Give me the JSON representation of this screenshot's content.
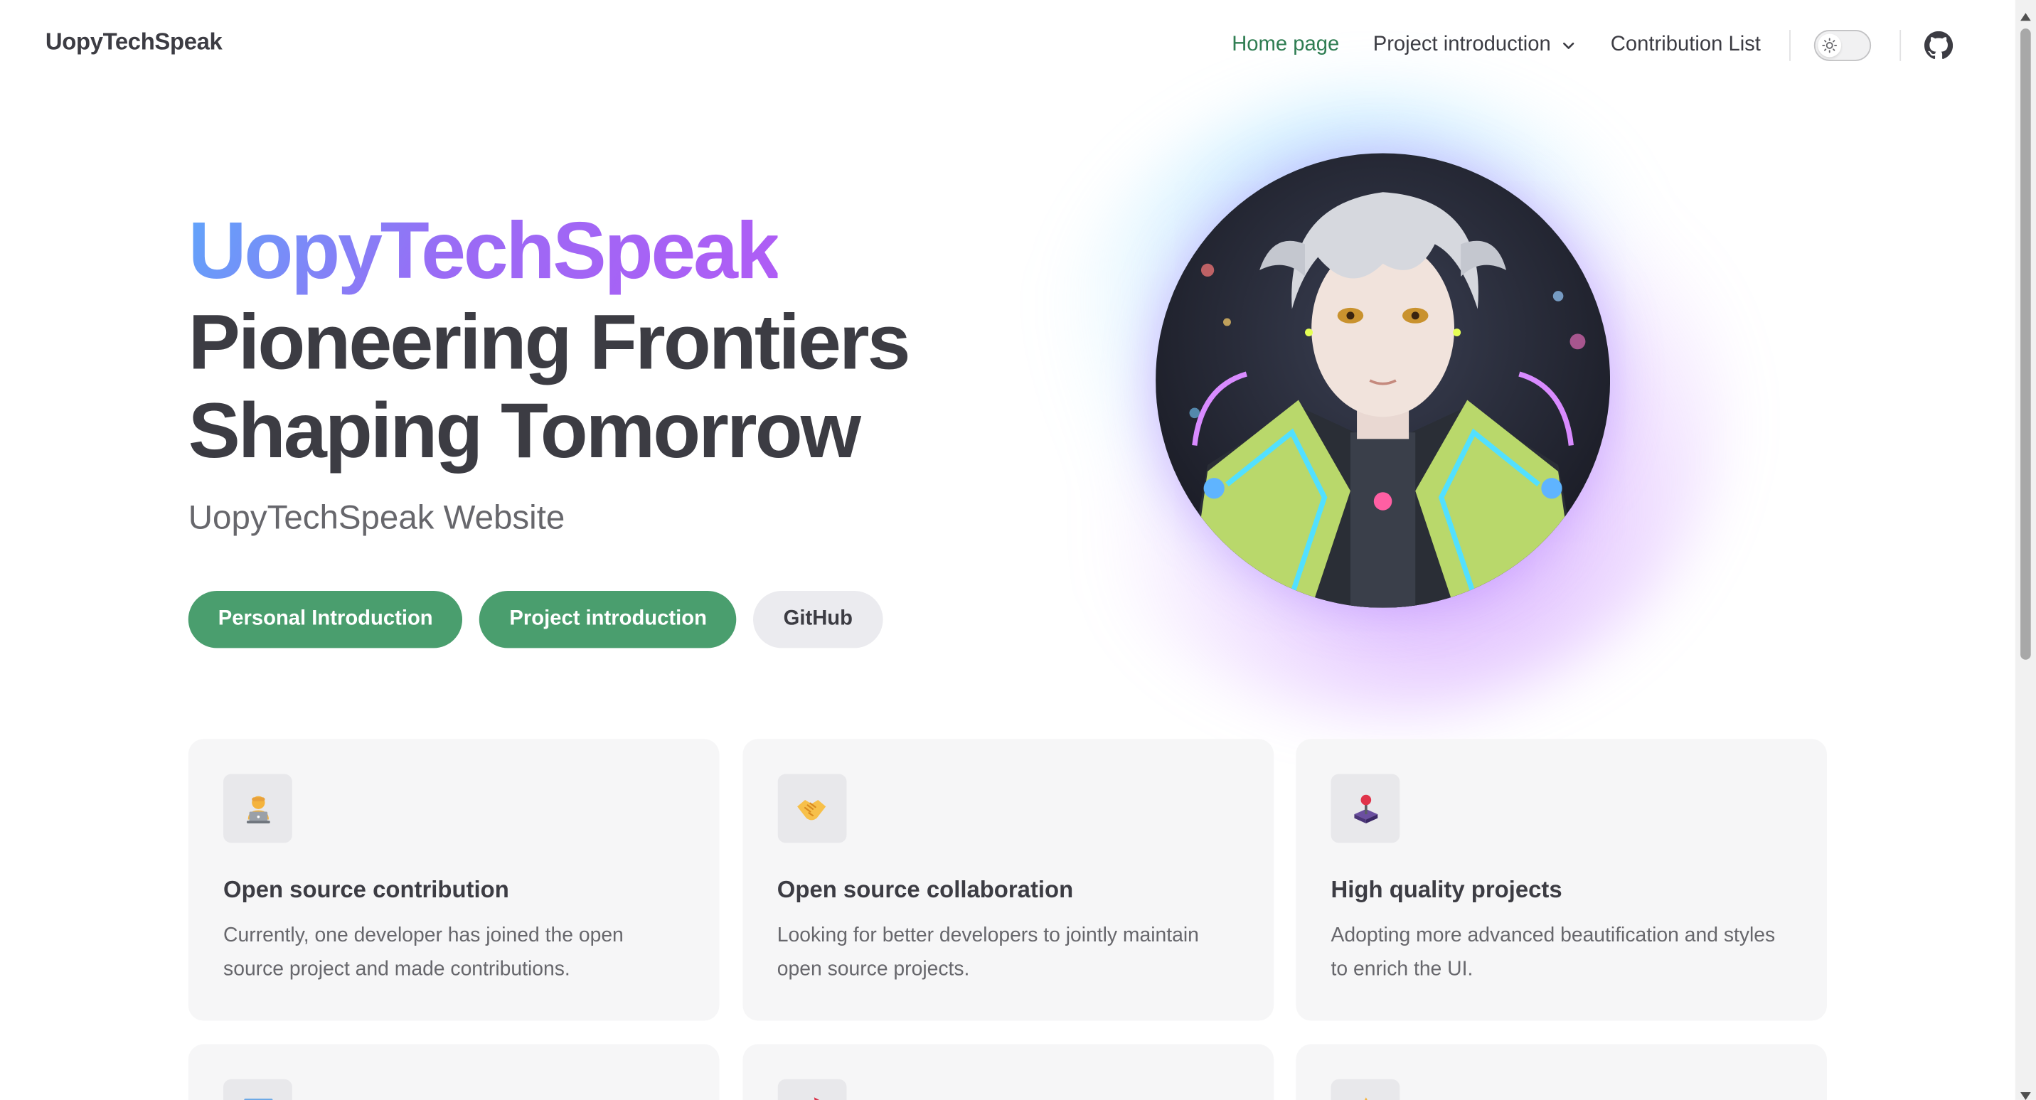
{
  "site": {
    "brand": "UopyTechSpeak"
  },
  "nav": {
    "items": [
      {
        "label": "Home page",
        "active": true
      },
      {
        "label": "Project introduction",
        "dropdown": true
      },
      {
        "label": "Contribution List"
      }
    ],
    "theme_toggle_icon": "sun-icon",
    "repo_icon": "github-icon"
  },
  "hero": {
    "name": "UopyTechSpeak",
    "text_line1": "Pioneering Frontiers",
    "text_line2": "Shaping Tomorrow",
    "tagline": "UopyTechSpeak Website",
    "actions": [
      {
        "label": "Personal Introduction",
        "theme": "brand"
      },
      {
        "label": "Project introduction",
        "theme": "brand"
      },
      {
        "label": "GitHub",
        "theme": "alt"
      }
    ],
    "image_alt": "anime character avatar"
  },
  "features": [
    {
      "icon": "technologist-icon",
      "title": "Open source contribution",
      "details": "Currently, one developer has joined the open source project and made contributions."
    },
    {
      "icon": "handshake-icon",
      "title": "Open source collaboration",
      "details": "Looking for better developers to jointly maintain open source projects."
    },
    {
      "icon": "joystick-icon",
      "title": "High quality projects",
      "details": "Adopting more advanced beautification and styles to enrich the UI."
    },
    {
      "icon": "monitor-icon",
      "title": "",
      "details": ""
    },
    {
      "icon": "rocket-icon",
      "title": "",
      "details": ""
    },
    {
      "icon": "star-icon",
      "title": "",
      "details": ""
    }
  ],
  "colors": {
    "brand_green": "#4a9e6e",
    "active_link": "#2f7d52",
    "text": "#3c3c43",
    "muted": "#67676c",
    "card_bg": "#f6f6f7",
    "gradient_start": "#60a5fa",
    "gradient_end": "#b05cf5"
  }
}
